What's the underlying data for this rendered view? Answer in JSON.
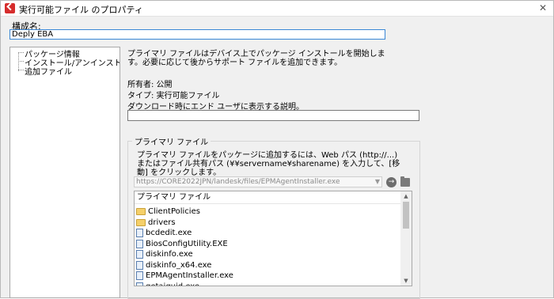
{
  "window": {
    "title": "実行可能ファイル のプロパティ",
    "close_glyph": "✕"
  },
  "name": {
    "label": "構成名:",
    "value": "Deply EBA"
  },
  "tree": {
    "items": [
      {
        "label": "パッケージ情報"
      },
      {
        "label": "インストール/アンインストール オプション"
      },
      {
        "label": "追加ファイル"
      }
    ]
  },
  "main": {
    "description": "プライマリ ファイルはデバイス上でパッケージ インストールを開始します。必要に応じて後からサポート ファイルを追加できます。",
    "owner": "所有者: 公開",
    "type": "タイプ: 実行可能ファイル",
    "download_label": "ダウンロード時にエンド ユーザに表示する説明。",
    "download_value": ""
  },
  "primary_file": {
    "group_title": "プライマリ ファイル",
    "description": "プライマリ ファイルをパッケージに追加するには、Web パス (http://...) またはファイル共有パス (¥¥servername¥sharename) を入力して、[移動] をクリックします。",
    "url": "https://CORE2022JPN/landesk/files/EPMAgentInstaller.exe",
    "list_header": "プライマリ ファイル",
    "files": [
      {
        "name": "ClientPolicies",
        "kind": "folder"
      },
      {
        "name": "drivers",
        "kind": "folder"
      },
      {
        "name": "bcdedit.exe",
        "kind": "file"
      },
      {
        "name": "BiosConfigUtility.EXE",
        "kind": "file"
      },
      {
        "name": "diskinfo.exe",
        "kind": "file"
      },
      {
        "name": "diskinfo_x64.exe",
        "kind": "file"
      },
      {
        "name": "EPMAgentInstaller.exe",
        "kind": "file"
      },
      {
        "name": "getaiguid.exe",
        "kind": "file"
      }
    ]
  },
  "icons": {
    "app": "app-icon",
    "go": "go-arrow-icon",
    "browse": "folder-icon"
  }
}
